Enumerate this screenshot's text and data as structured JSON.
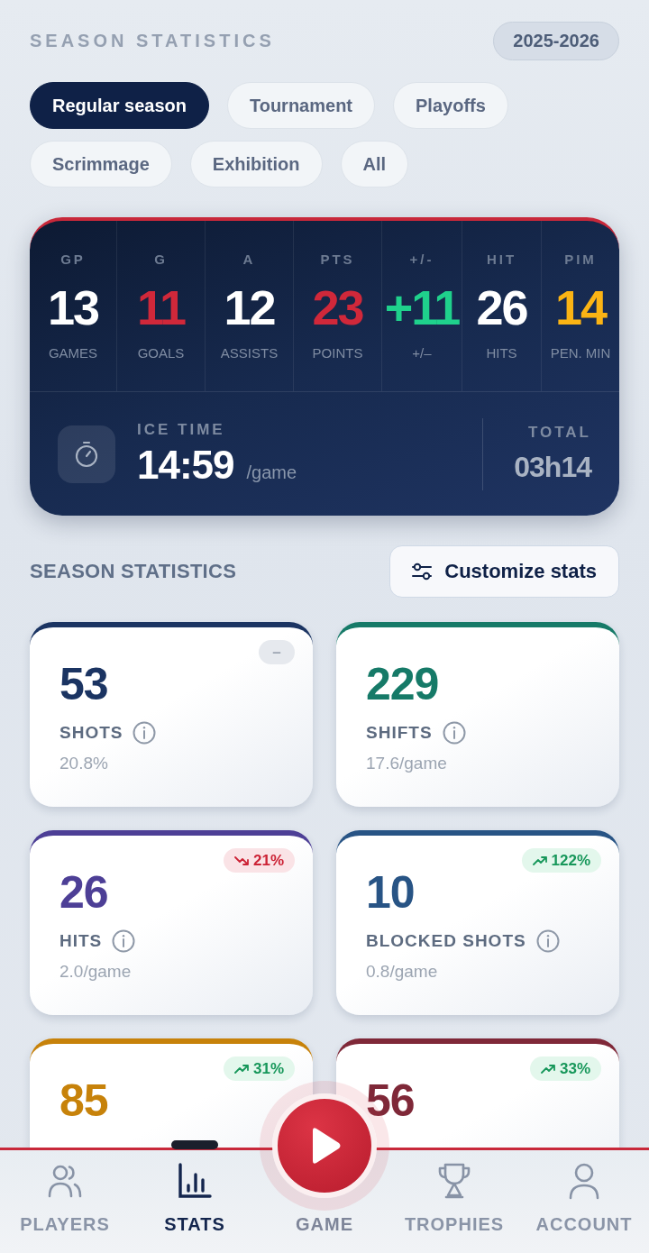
{
  "header": {
    "title": "SEASON STATISTICS",
    "season": "2025-2026"
  },
  "filters": [
    {
      "label": "Regular season",
      "selected": true
    },
    {
      "label": "Tournament",
      "selected": false
    },
    {
      "label": "Playoffs",
      "selected": false
    },
    {
      "label": "Scrimmage",
      "selected": false
    },
    {
      "label": "Exhibition",
      "selected": false
    },
    {
      "label": "All",
      "selected": false
    }
  ],
  "scoreboard": {
    "stats": [
      {
        "abbr": "GP",
        "value": "13",
        "label": "GAMES",
        "color": "#ffffff"
      },
      {
        "abbr": "G",
        "value": "11",
        "label": "GOALS",
        "color": "#d0283a"
      },
      {
        "abbr": "A",
        "value": "12",
        "label": "ASSISTS",
        "color": "#ffffff"
      },
      {
        "abbr": "PTS",
        "value": "23",
        "label": "POINTS",
        "color": "#d0283a"
      },
      {
        "abbr": "+/-",
        "value": "+11",
        "label": "+/–",
        "color": "#1fd18c"
      },
      {
        "abbr": "HIT",
        "value": "26",
        "label": "HITS",
        "color": "#ffffff"
      },
      {
        "abbr": "PIM",
        "value": "14",
        "label": "PEN. MIN",
        "color": "#fbb414"
      }
    ],
    "ice_time": {
      "label": "ICE TIME",
      "value": "14:59",
      "unit": "/game"
    },
    "total": {
      "label": "TOTAL",
      "value": "03h14"
    }
  },
  "section": {
    "title": "SEASON STATISTICS",
    "customize_button": "Customize stats"
  },
  "cards": [
    {
      "value": "53",
      "label": "SHOTS",
      "sub": "20.8%",
      "color": "#1b3462",
      "trend": {
        "kind": "neutral",
        "text": "–"
      }
    },
    {
      "value": "229",
      "label": "SHIFTS",
      "sub": "17.6/game",
      "color": "#167a68"
    },
    {
      "value": "26",
      "label": "HITS",
      "sub": "2.0/game",
      "color": "#4d3f96",
      "trend": {
        "kind": "down",
        "text": "21%"
      }
    },
    {
      "value": "10",
      "label": "BLOCKED SHOTS",
      "sub": "0.8/game",
      "color": "#285485",
      "trend": {
        "kind": "up",
        "text": "122%"
      }
    },
    {
      "value": "85",
      "color": "#c7820a",
      "trend": {
        "kind": "up",
        "text": "31%"
      }
    },
    {
      "value": "56",
      "color": "#7f2838",
      "trend": {
        "kind": "up",
        "text": "33%"
      }
    }
  ],
  "nav": {
    "items": [
      {
        "label": "PLAYERS",
        "kind": "players",
        "selected": false
      },
      {
        "label": "STATS",
        "kind": "stats",
        "selected": true
      },
      {
        "label": "GAME",
        "kind": "play",
        "selected": false
      },
      {
        "label": "TROPHIES",
        "kind": "trophy",
        "selected": false
      },
      {
        "label": "ACCOUNT",
        "kind": "account",
        "selected": false
      }
    ]
  }
}
